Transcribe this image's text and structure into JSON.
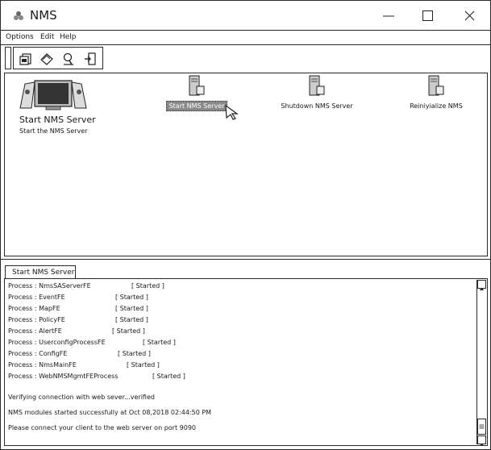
{
  "window": {
    "title": "NMS"
  },
  "menu": {
    "items": [
      "Options",
      "Edit",
      "Help"
    ]
  },
  "toolbar": {
    "icons": [
      "open-icon",
      "edit-icon",
      "search-icon",
      "exit-icon"
    ]
  },
  "hero": {
    "title": "Start NMS Server",
    "subtitle": "Start the NMS Server"
  },
  "actions": [
    {
      "label": "Start NMS Server",
      "selected": true
    },
    {
      "label": "Shutdown NMS Server",
      "selected": false
    },
    {
      "label": "Reiniyialize NMS",
      "selected": false
    }
  ],
  "log_tab": {
    "label": "Start NMS Server"
  },
  "log": {
    "processes": [
      {
        "name": "Process : NmsSAServerFE",
        "status": "[ Started ]"
      },
      {
        "name": "Process : EventFE",
        "status": "[ Started ]"
      },
      {
        "name": "Process : MapFE",
        "status": "[ Started ]"
      },
      {
        "name": "Process : PolicyFE",
        "status": "[ Started ]"
      },
      {
        "name": "Process : AlertFE",
        "status": "[ Started ]"
      },
      {
        "name": "Process : UserconfigProcessFE",
        "status": "[ Started ]"
      },
      {
        "name": "Process : ConfigFE",
        "status": "[ Started ]"
      },
      {
        "name": "Process : NmsMainFE",
        "status": "[ Started ]"
      },
      {
        "name": "Process : WebNMSMgmtFEProcess",
        "status": "[ Started ]"
      }
    ],
    "messages": [
      "Verifying connection with web sever...verified",
      "NMS modules started successfully at Oct 08,2018 02:44:50 PM",
      "Please connect your client to the web server on port 9090"
    ]
  }
}
